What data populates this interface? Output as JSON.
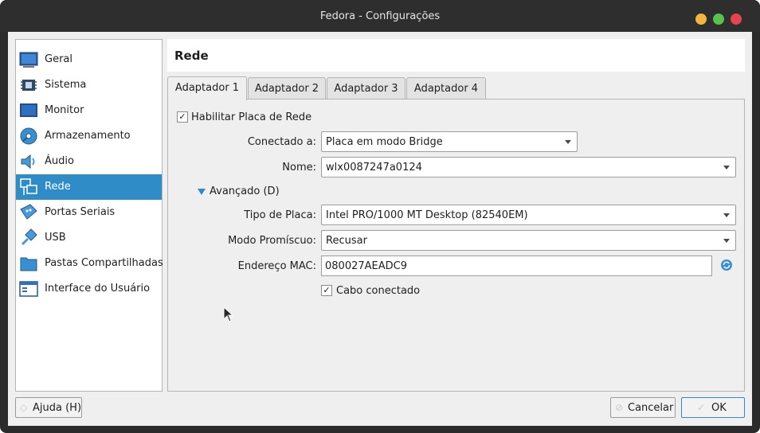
{
  "window": {
    "title": "Fedora - Configurações"
  },
  "sidebar": {
    "items": [
      {
        "label": "Geral",
        "icon": "monitor-icon"
      },
      {
        "label": "Sistema",
        "icon": "chip-icon"
      },
      {
        "label": "Monitor",
        "icon": "display-icon"
      },
      {
        "label": "Armazenamento",
        "icon": "disk-icon"
      },
      {
        "label": "Áudio",
        "icon": "speaker-icon"
      },
      {
        "label": "Rede",
        "icon": "network-icon",
        "selected": true
      },
      {
        "label": "Portas Seriais",
        "icon": "serial-port-icon"
      },
      {
        "label": "USB",
        "icon": "usb-icon"
      },
      {
        "label": "Pastas Compartilhadas",
        "icon": "folder-icon"
      },
      {
        "label": "Interface do Usuário",
        "icon": "ui-window-icon"
      }
    ]
  },
  "header": {
    "title": "Rede"
  },
  "tabs": [
    {
      "label": "Adaptador 1",
      "active": true
    },
    {
      "label": "Adaptador 2"
    },
    {
      "label": "Adaptador 3"
    },
    {
      "label": "Adaptador 4"
    }
  ],
  "form": {
    "enable_label": "Habilitar Placa de Rede",
    "enable_checked": true,
    "attached_label": "Conectado a:",
    "attached_value": "Placa em modo Bridge",
    "name_label": "Nome:",
    "name_value": "wlx0087247a0124",
    "advanced_label": "Avançado (D)",
    "adapter_type_label": "Tipo de Placa:",
    "adapter_type_value": "Intel PRO/1000 MT Desktop (82540EM)",
    "promisc_label": "Modo Promíscuo:",
    "promisc_value": "Recusar",
    "mac_label": "Endereço MAC:",
    "mac_value": "080027AEADC9",
    "cable_label": "Cabo conectado",
    "cable_checked": true
  },
  "buttons": {
    "help": "Ajuda (H)",
    "cancel": "Cancelar",
    "ok": "OK"
  },
  "colors": {
    "selection": "#308cc6",
    "titlebar": "#2e2e2e",
    "close": "#e6434f",
    "minimize": "#f4b43d",
    "maximize": "#58c24a"
  }
}
